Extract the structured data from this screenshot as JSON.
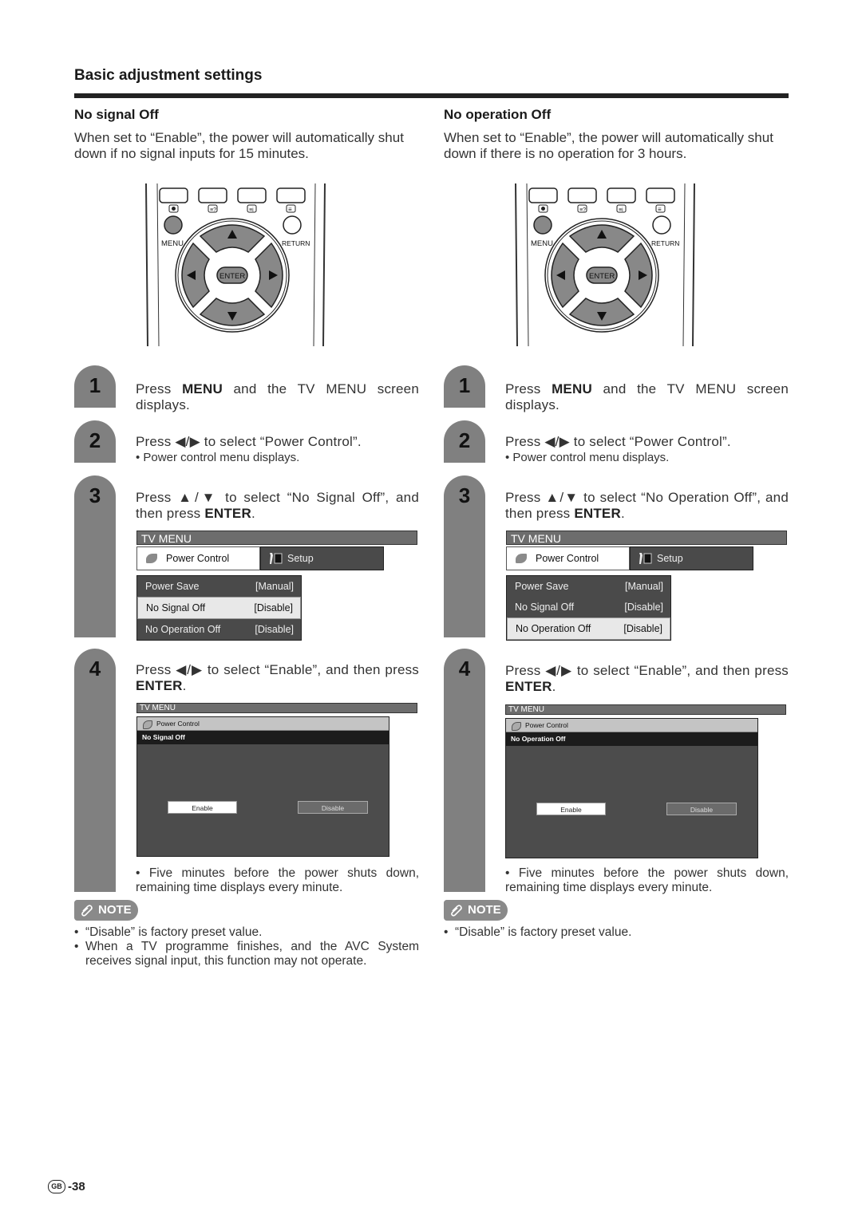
{
  "page": {
    "section_title": "Basic adjustment settings",
    "page_region": "GB",
    "page_number": "-38"
  },
  "remote": {
    "menu_label": "MENU",
    "return_label": "RETURN",
    "enter_label": "ENTER"
  },
  "columns": [
    {
      "title": "No signal Off",
      "intro": "When set to “Enable”, the power will automatically shut down if no signal inputs for 15 minutes.",
      "steps": [
        {
          "num": "1",
          "pre": "Press ",
          "bold": "MENU",
          "post": " and the TV MENU screen displays."
        },
        {
          "num": "2",
          "text": "Press ◀/▶ to select “Power Control”.",
          "note": "• Power control menu displays."
        },
        {
          "num": "3",
          "pre": "Press ▲/▼ to select “No Signal Off”, and then press ",
          "bold": "ENTER",
          "post": "."
        },
        {
          "num": "4",
          "pre": "Press ◀/▶ to select “Enable”, and then press ",
          "bold": "ENTER",
          "post": "."
        }
      ],
      "menu": {
        "title": "TV MENU",
        "tabs": [
          "Power Control",
          "Setup"
        ],
        "rows": [
          {
            "label": "Power Save",
            "value": "[Manual]"
          },
          {
            "label": "No Signal Off",
            "value": "[Disable]"
          },
          {
            "label": "No Operation Off",
            "value": "[Disable]"
          }
        ],
        "selected_index": 1
      },
      "dialog": {
        "title": "TV MENU",
        "header": "Power Control",
        "subheader": "No Signal Off",
        "enable": "Enable",
        "disable": "Disable"
      },
      "step4_note": "• Five minutes before the power shuts down, remaining time displays every minute.",
      "note_label": "NOTE",
      "notes": [
        "“Disable” is factory preset value.",
        "When a TV programme finishes, and the AVC System receives signal input, this function may not operate."
      ]
    },
    {
      "title": "No operation Off",
      "intro": "When set to “Enable”, the power will automatically shut down if there is no operation for 3 hours.",
      "steps": [
        {
          "num": "1",
          "pre": "Press ",
          "bold": "MENU",
          "post": " and the TV MENU screen displays."
        },
        {
          "num": "2",
          "text": "Press ◀/▶ to select “Power Control”.",
          "note": "• Power control menu displays."
        },
        {
          "num": "3",
          "pre": "Press ▲/▼ to select “No Operation Off”, and then press ",
          "bold": "ENTER",
          "post": "."
        },
        {
          "num": "4",
          "pre": "Press ◀/▶ to select “Enable”, and then press ",
          "bold": "ENTER",
          "post": "."
        }
      ],
      "menu": {
        "title": "TV MENU",
        "tabs": [
          "Power Control",
          "Setup"
        ],
        "rows": [
          {
            "label": "Power Save",
            "value": "[Manual]"
          },
          {
            "label": "No Signal Off",
            "value": "[Disable]"
          },
          {
            "label": "No Operation Off",
            "value": "[Disable]"
          }
        ],
        "selected_index": 2
      },
      "dialog": {
        "title": "TV MENU",
        "header": "Power Control",
        "subheader": "No Operation Off",
        "enable": "Enable",
        "disable": "Disable"
      },
      "step4_note": "•    Five minutes before the power shuts down, remaining time displays every minute.",
      "note_label": "NOTE",
      "notes": [
        "“Disable” is factory preset value."
      ]
    }
  ]
}
